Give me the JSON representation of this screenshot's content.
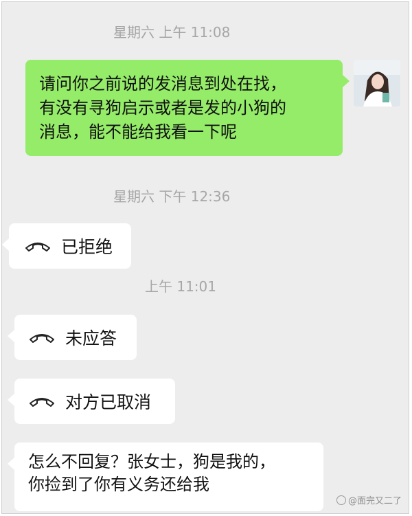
{
  "timestamps": {
    "t1": "星期六 上午 11:08",
    "t2": "星期六 下午 12:36",
    "t3": "上午 11:01"
  },
  "outgoing_message": {
    "lines": [
      "请问你之前说的发消息到处在找，",
      "有没有寻狗启示或者是发的小狗的",
      "消息，能不能给我看一下呢"
    ]
  },
  "calls": [
    {
      "label": "已拒绝",
      "icon": "phone-hangup-icon"
    },
    {
      "label": "未应答",
      "icon": "phone-hangup-icon"
    },
    {
      "label": "对方已取消",
      "icon": "phone-hangup-icon"
    }
  ],
  "incoming_message": {
    "lines": [
      "怎么不回复？张女士，狗是我的，",
      "你捡到了你有义务还给我"
    ]
  },
  "watermark": {
    "text": "@面完又二了"
  },
  "colors": {
    "background": "#ededed",
    "outgoing_bubble": "#95ec69",
    "incoming_bubble": "#ffffff",
    "timestamp": "#a6a6a6"
  }
}
